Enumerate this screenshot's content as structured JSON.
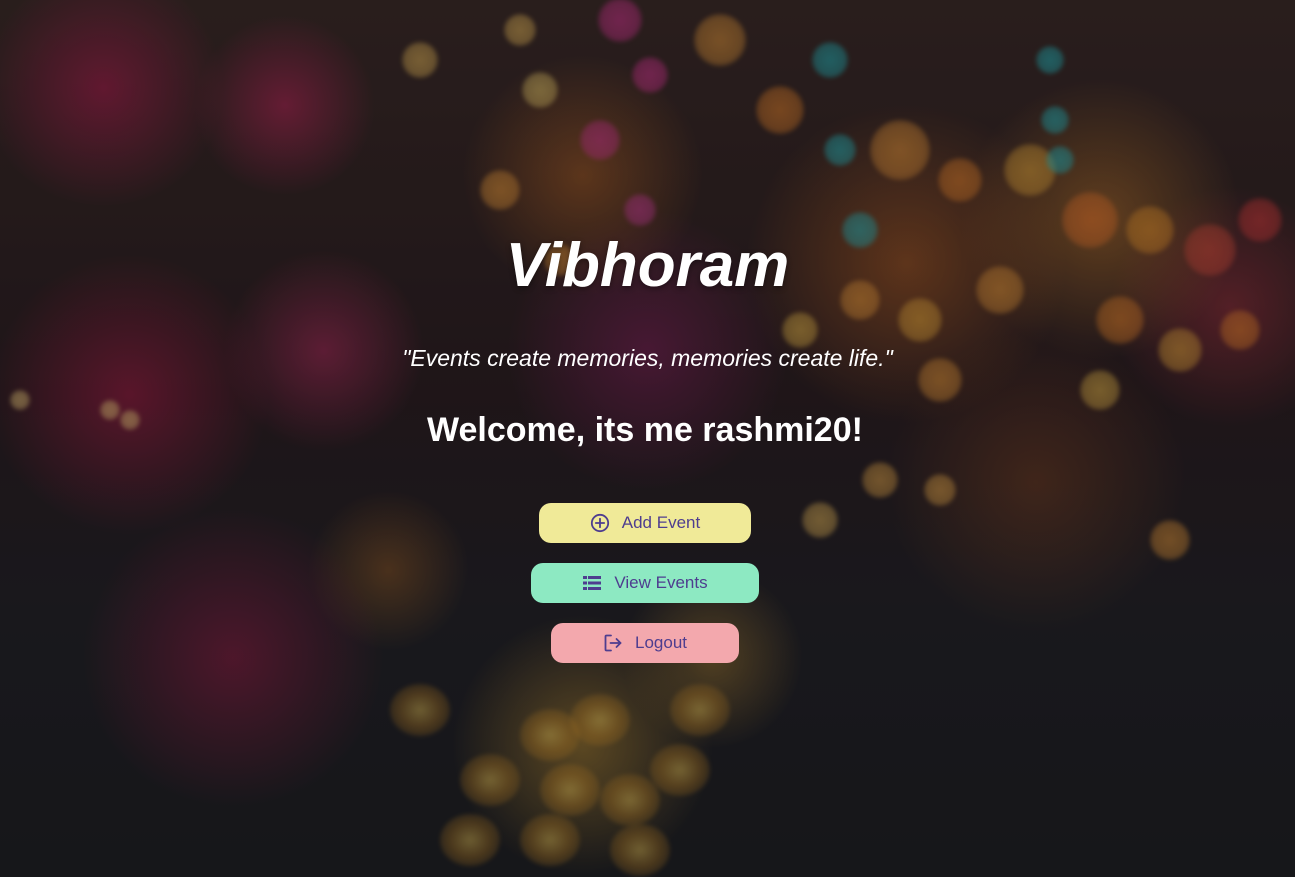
{
  "app": {
    "title": "Vibhoram",
    "tagline": "\"Events create memories, memories create life.\"",
    "welcome": "Welcome, its me rashmi20!"
  },
  "actions": [
    {
      "label": "Add Event",
      "icon": "plus-circle-icon",
      "color": "#f0ea98"
    },
    {
      "label": "View Events",
      "icon": "list-icon",
      "color": "#8de9c2"
    },
    {
      "label": "Logout",
      "icon": "logout-icon",
      "color": "#f3a8ad"
    }
  ],
  "theme": {
    "button_text_color": "#4e3d8f"
  }
}
